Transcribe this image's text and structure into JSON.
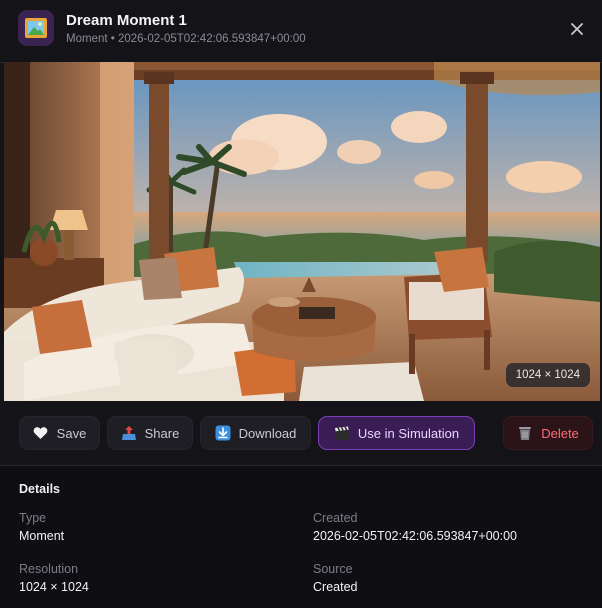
{
  "header": {
    "title": "Dream Moment 1",
    "subtitle": "Moment • 2026-02-05T02:42:06.593847+00:00",
    "icon": "framed-picture-icon",
    "close_icon": "close-icon"
  },
  "image": {
    "resolution_badge": "1024 × 1024",
    "description_icon": "resort-villa-image"
  },
  "actions": {
    "save": "Save",
    "share": "Share",
    "download": "Download",
    "simulation": "Use in Simulation",
    "delete": "Delete"
  },
  "details": {
    "heading": "Details",
    "type_label": "Type",
    "type_value": "Moment",
    "created_label": "Created",
    "created_value": "2026-02-05T02:42:06.593847+00:00",
    "resolution_label": "Resolution",
    "resolution_value": "1024 × 1024",
    "source_label": "Source",
    "source_value": "Created"
  },
  "colors": {
    "accent": "#7b3fb8",
    "danger": "#ff6b78",
    "background": "#141418"
  }
}
